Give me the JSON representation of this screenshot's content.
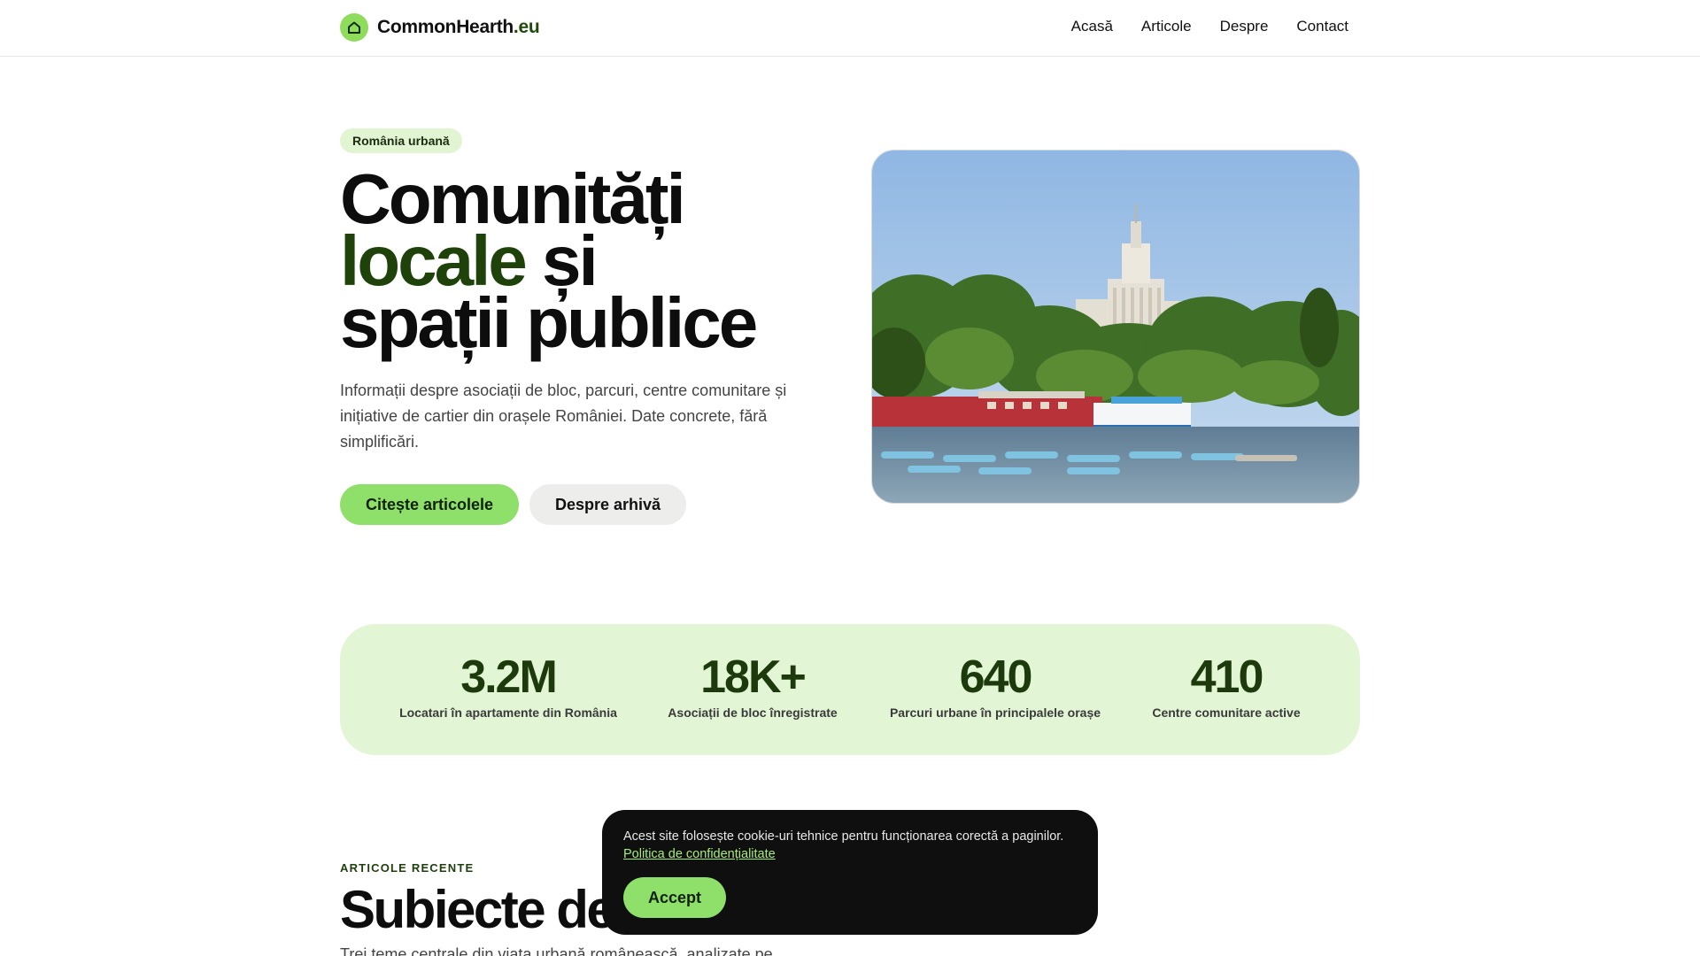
{
  "header": {
    "logo_name": "CommonHearth",
    "logo_tld": ".eu",
    "nav": [
      "Acasă",
      "Articole",
      "Despre",
      "Contact"
    ]
  },
  "hero": {
    "badge": "România urbană",
    "title_line1": "Comunități",
    "title_line2_green": "locale",
    "title_line2_rest": " și",
    "title_line3": "spații publice",
    "description": "Informații despre asociații de bloc, parcuri, centre comunitare și inițiative de cartier din orașele României. Date concrete, fără simplificări.",
    "primary_cta": "Citește articolele",
    "secondary_cta": "Despre arhivă"
  },
  "stats": [
    {
      "value": "3.2M",
      "label": "Locatari în apartamente din România"
    },
    {
      "value": "18K+",
      "label": "Asociații de bloc înregistrate"
    },
    {
      "value": "640",
      "label": "Parcuri urbane în principalele orașe"
    },
    {
      "value": "410",
      "label": "Centre comunitare active"
    }
  ],
  "recent": {
    "kicker": "ARTICOLE RECENTE",
    "title": "Subiecte de interes",
    "description": "Trei teme centrale din viața urbană românească, analizate pe"
  },
  "cookie": {
    "text": "Acest site folosește cookie-uri tehnice pentru funcționarea corectă a paginilor.",
    "link": "Politica de confidențialitate",
    "accept": "Accept"
  },
  "colors": {
    "accent": "#8fe06a",
    "dark_green": "#1e4209",
    "stats_bg": "#e2f5d5"
  }
}
